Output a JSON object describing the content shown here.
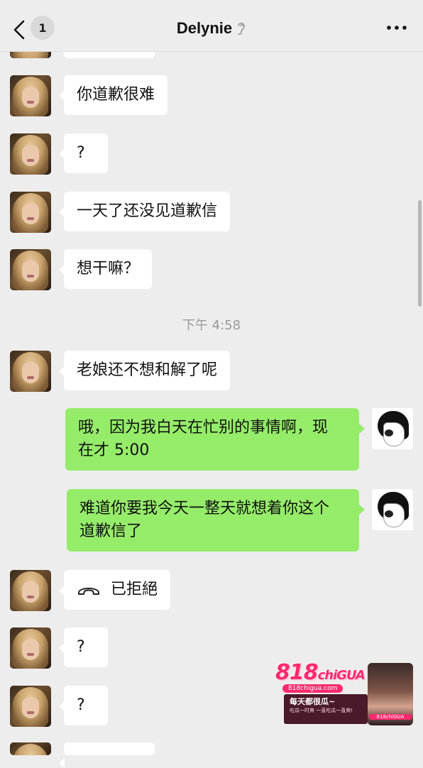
{
  "header": {
    "back_badge": "1",
    "title": "Delynie",
    "colors": {
      "background": "#ededed"
    }
  },
  "messages": [
    {
      "side": "left",
      "text": "你道歉很难"
    },
    {
      "side": "left",
      "text": "?"
    },
    {
      "side": "left",
      "text": "一天了还没见道歉信"
    },
    {
      "side": "left",
      "text": "想干嘛？"
    },
    {
      "type": "time",
      "text": "下午 4:58"
    },
    {
      "side": "left",
      "text": "老娘还不想和解了呢"
    },
    {
      "side": "right",
      "line1": "哦，因为我白天在忙别的事情啊，现",
      "line2": "在才 5:00"
    },
    {
      "side": "right",
      "line1": "难道你要我今天一整天就想着你这个",
      "line2": "道歉信了"
    },
    {
      "side": "left",
      "type": "call",
      "text": "已拒絕",
      "icon": "phone-hangup-icon"
    },
    {
      "side": "left",
      "text": "?"
    },
    {
      "side": "left",
      "text": "?"
    }
  ],
  "watermark": {
    "logo_num": "818",
    "logo_word": "chiGUA",
    "site": "818chigua.com",
    "slogan": "每天都很瓜~",
    "sub": "吃瓜一时爽 一直吃瓜一直爽!",
    "badge": "818chiGUA"
  },
  "colors": {
    "bubble_incoming": "#ffffff",
    "bubble_outgoing": "#95ec69",
    "timestamp": "#9a9a9a"
  }
}
